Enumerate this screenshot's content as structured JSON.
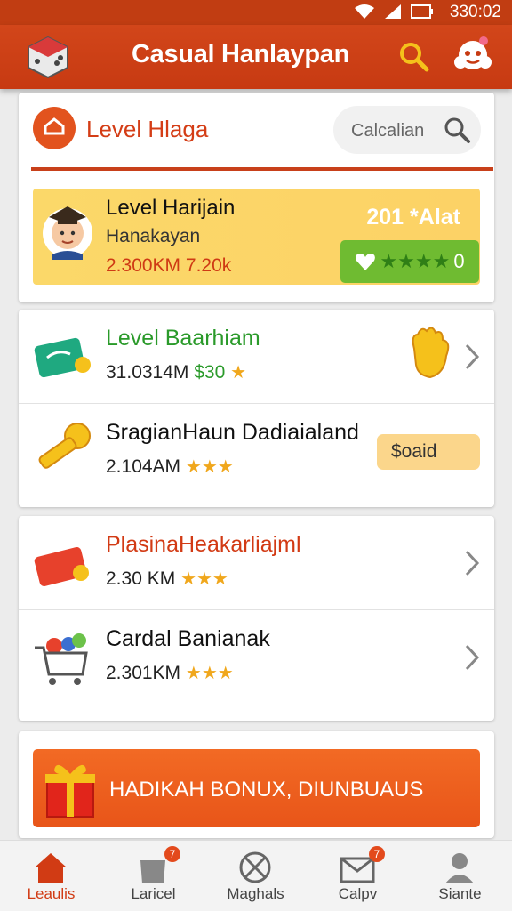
{
  "status": {
    "time": "330:02"
  },
  "app": {
    "title": "Casual Hanlaypan"
  },
  "search": {
    "label": "Level Hlaga",
    "placeholder": "Calcalian"
  },
  "featured": {
    "name": "Level Harijain",
    "subtitle": "Hanakayan",
    "stats": "2.300KM 7.20k",
    "amount": "201 *Alat",
    "rating_stars": "★★★★",
    "rating_value": "0"
  },
  "items": [
    {
      "title": "Level Baarhiam",
      "meta": "31.0314M",
      "price": "$30",
      "stars": "★",
      "title_color": "#2a9a2a",
      "action": "chevron"
    },
    {
      "title": "SragianHaun Dadiaialand",
      "meta": "2.104AM",
      "stars": "★★★",
      "button": "$oaid",
      "title_color": "#111111",
      "action": "button"
    },
    {
      "title": "PlasinaHeakarliajml",
      "meta": "2.30 KM",
      "stars": "★★★",
      "title_color": "#d23a14",
      "action": "chevron"
    },
    {
      "title": "Cardal Banianak",
      "meta": "2.301KM",
      "stars": "★★★",
      "title_color": "#111111",
      "action": "chevron"
    }
  ],
  "bonus": {
    "label": "HADIKAH BONUX, DIUNBUAUS"
  },
  "nav": [
    {
      "label": "Leaulis",
      "icon": "home-icon",
      "badge": ""
    },
    {
      "label": "Laricel",
      "icon": "bag-icon",
      "badge": "7"
    },
    {
      "label": "Maghals",
      "icon": "compass-icon",
      "badge": ""
    },
    {
      "label": "Calpv",
      "icon": "mail-icon",
      "badge": "7"
    },
    {
      "label": "Siante",
      "icon": "profile-icon",
      "badge": ""
    }
  ],
  "colors": {
    "primary": "#c73a12",
    "accent": "#e85519",
    "featured_bg": "#fbd869",
    "rating_green": "#6fbb31"
  }
}
